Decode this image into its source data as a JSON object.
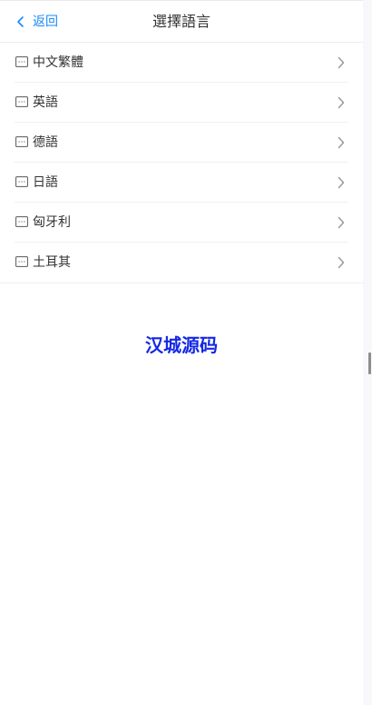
{
  "header": {
    "back_label": "返回",
    "title": "選擇語言"
  },
  "languages": [
    {
      "label": "中文繁體",
      "icon": "message-icon"
    },
    {
      "label": "英語",
      "icon": "message-icon"
    },
    {
      "label": "德語",
      "icon": "message-icon"
    },
    {
      "label": "日語",
      "icon": "message-icon"
    },
    {
      "label": "匈牙利",
      "icon": "message-icon"
    },
    {
      "label": "土耳其",
      "icon": "message-icon"
    }
  ],
  "watermark": "汉城源码",
  "colors": {
    "accent": "#1989fa",
    "text": "#323233",
    "chevron": "#969799",
    "watermark": "#1428e6"
  }
}
